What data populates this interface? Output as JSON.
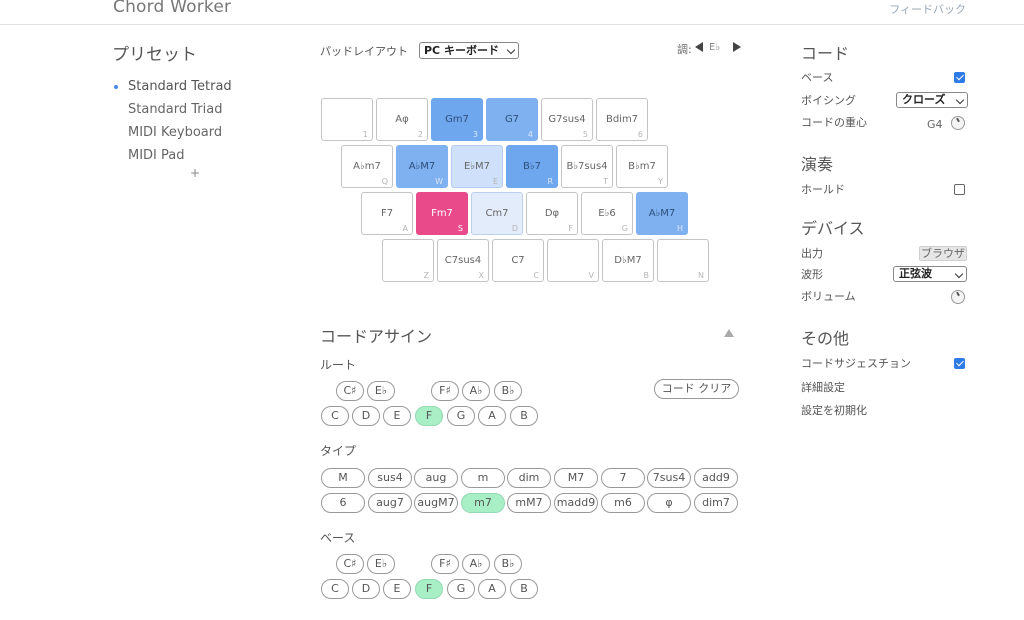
{
  "header": {
    "app_title": "Chord Worker",
    "feedback_link": "フィードバック"
  },
  "presets": {
    "title": "プリセット",
    "items": [
      "Standard Tetrad",
      "Standard Triad",
      "MIDI Keyboard",
      "MIDI Pad"
    ],
    "active_index": 0,
    "add_label": "+"
  },
  "pad_layout": {
    "label": "パッドレイアウト",
    "selected": "PC キーボード"
  },
  "key_selector": {
    "label": "調:",
    "value": "E♭"
  },
  "pads": [
    [
      {
        "chord": "",
        "key": "1",
        "state": "normal"
      },
      {
        "chord": "Aφ",
        "key": "2",
        "state": "normal"
      },
      {
        "chord": "Gm7",
        "key": "3",
        "state": "blue"
      },
      {
        "chord": "G7",
        "key": "4",
        "state": "blue2"
      },
      {
        "chord": "G7sus4",
        "key": "5",
        "state": "normal"
      },
      {
        "chord": "Bdim7",
        "key": "6",
        "state": "normal"
      }
    ],
    [
      {
        "chord": "A♭m7",
        "key": "Q",
        "state": "normal"
      },
      {
        "chord": "A♭M7",
        "key": "W",
        "state": "blue2"
      },
      {
        "chord": "E♭M7",
        "key": "E",
        "state": "light"
      },
      {
        "chord": "B♭7",
        "key": "R",
        "state": "blue"
      },
      {
        "chord": "B♭7sus4",
        "key": "T",
        "state": "normal"
      },
      {
        "chord": "B♭m7",
        "key": "Y",
        "state": "normal"
      }
    ],
    [
      {
        "chord": "F7",
        "key": "A",
        "state": "normal"
      },
      {
        "chord": "Fm7",
        "key": "S",
        "state": "pink"
      },
      {
        "chord": "Cm7",
        "key": "D",
        "state": "lighter"
      },
      {
        "chord": "Dφ",
        "key": "F",
        "state": "normal"
      },
      {
        "chord": "E♭6",
        "key": "G",
        "state": "normal"
      },
      {
        "chord": "A♭M7",
        "key": "H",
        "state": "blue2"
      }
    ],
    [
      {
        "chord": "",
        "key": "Z",
        "state": "normal"
      },
      {
        "chord": "C7sus4",
        "key": "X",
        "state": "normal"
      },
      {
        "chord": "C7",
        "key": "C",
        "state": "normal"
      },
      {
        "chord": "",
        "key": "V",
        "state": "normal"
      },
      {
        "chord": "D♭M7",
        "key": "B",
        "state": "normal"
      },
      {
        "chord": "",
        "key": "N",
        "state": "normal"
      }
    ]
  ],
  "chord_assign": {
    "title": "コードアサイン",
    "clear_label": "コード クリア",
    "root_label": "ルート",
    "root_accidentals": [
      "C♯",
      "E♭",
      "F♯",
      "A♭",
      "B♭"
    ],
    "root_naturals": [
      "C",
      "D",
      "E",
      "F",
      "G",
      "A",
      "B"
    ],
    "root_selected": "F",
    "type_label": "タイプ",
    "types_row1": [
      "M",
      "sus4",
      "aug",
      "m",
      "dim",
      "M7",
      "7",
      "7sus4",
      "add9"
    ],
    "types_row2": [
      "6",
      "aug7",
      "augM7",
      "m7",
      "mM7",
      "madd9",
      "m6",
      "φ",
      "dim7"
    ],
    "type_selected": "m7",
    "bass_label": "ベース",
    "bass_accidentals": [
      "C♯",
      "E♭",
      "F♯",
      "A♭",
      "B♭"
    ],
    "bass_naturals": [
      "C",
      "D",
      "E",
      "F",
      "G",
      "A",
      "B"
    ],
    "bass_selected": "F"
  },
  "right_panel": {
    "chord_section": "コード",
    "bass_label": "ベース",
    "bass_checked": true,
    "voicing_label": "ボイシング",
    "voicing_value": "クローズ",
    "center_label": "コードの重心",
    "center_value": "G4",
    "play_section": "演奏",
    "hold_label": "ホールド",
    "hold_checked": false,
    "device_section": "デバイス",
    "output_label": "出力",
    "output_value": "ブラウザ",
    "waveform_label": "波形",
    "waveform_value": "正弦波",
    "volume_label": "ボリューム",
    "other_section": "その他",
    "suggest_label": "コードサジェスチョン",
    "suggest_checked": true,
    "advanced_label": "詳細設定",
    "reset_label": "設定を初期化"
  },
  "colors": {
    "accent_blue": "#2f7be6",
    "pad_blue": "#6fa7ee",
    "pad_pink": "#e84a8a",
    "chip_selected": "#a8efc6"
  }
}
